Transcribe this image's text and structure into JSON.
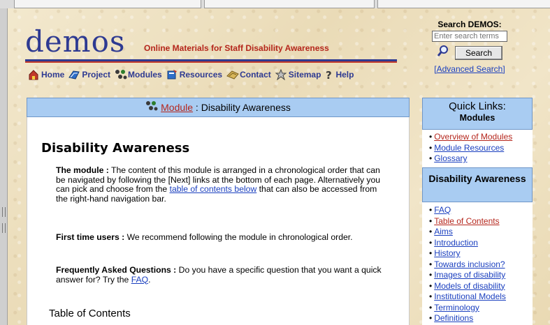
{
  "header": {
    "logo": "demos",
    "tagline": "Online Materials for Staff Disability Awareness"
  },
  "nav": [
    {
      "label": "Home",
      "icon": "home-icon"
    },
    {
      "label": "Project",
      "icon": "project-icon"
    },
    {
      "label": "Modules",
      "icon": "modules-icon"
    },
    {
      "label": "Resources",
      "icon": "resources-icon"
    },
    {
      "label": "Contact",
      "icon": "contact-icon"
    },
    {
      "label": "Sitemap",
      "icon": "sitemap-icon"
    },
    {
      "label": "Help",
      "icon": "help-icon"
    }
  ],
  "search": {
    "label": "Search DEMOS:",
    "placeholder": "Enter search terms",
    "button": "Search",
    "advanced": "[Advanced Search]"
  },
  "main": {
    "breadcrumb_link": "Module",
    "breadcrumb_rest": " : Disability Awareness",
    "title": "Disability Awareness",
    "p1_bold": "The module :",
    "p1_text": " The content of this module is arranged in a chronological order that can be navigated by following the [Next] links at the bottom of each page. Alternatively you can pick and choose from the ",
    "p1_link": "table of contents below",
    "p1_text2": " that can also be accessed from the right-hand navigation bar.",
    "p2_bold": "First time users :",
    "p2_text": " We recommend following the module in chronological order.",
    "p3_bold": "Frequently Asked Questions :",
    "p3_text": " Do you have a specific question that you want a quick answer for? Try the ",
    "p3_link": "FAQ",
    "p3_text2": ".",
    "toc": "Table of Contents"
  },
  "quicklinks": {
    "title": "Quick Links:",
    "subtitle": "Modules",
    "items": [
      "Overview of Modules",
      "Module Resources",
      "Glossary"
    ],
    "section_title": "Disability Awareness",
    "section_items": [
      "FAQ",
      "Table of Contents",
      "Aims",
      "Introduction",
      "History",
      "Towards inclusion?",
      "Images of disability",
      "Models of disability",
      "Institutional Models",
      "Terminology",
      "Definitions"
    ]
  },
  "colors": {
    "brand_blue": "#2e3a92",
    "accent_red": "#b5261c",
    "panel_blue": "#a9ccf2",
    "link_blue": "#1a3fbf"
  }
}
